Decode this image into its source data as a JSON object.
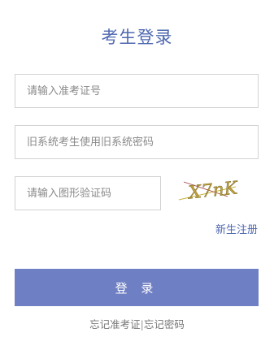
{
  "title": "考生登录",
  "fields": {
    "exam_id": {
      "placeholder": "请输入准考证号",
      "value": ""
    },
    "password": {
      "placeholder": "旧系统考生使用旧系统密码",
      "value": ""
    },
    "captcha": {
      "placeholder": "请输入图形验证码",
      "value": ""
    }
  },
  "captcha_image": {
    "text": "X7nK"
  },
  "register_link": "新生注册",
  "login_button": "登 录",
  "forgot": {
    "exam_id_link": "忘记准考证",
    "separator": "|",
    "password_link": "忘记密码"
  },
  "colors": {
    "accent": "#4f68b0",
    "button": "#6f7fc4",
    "border": "#d2d2d2"
  }
}
